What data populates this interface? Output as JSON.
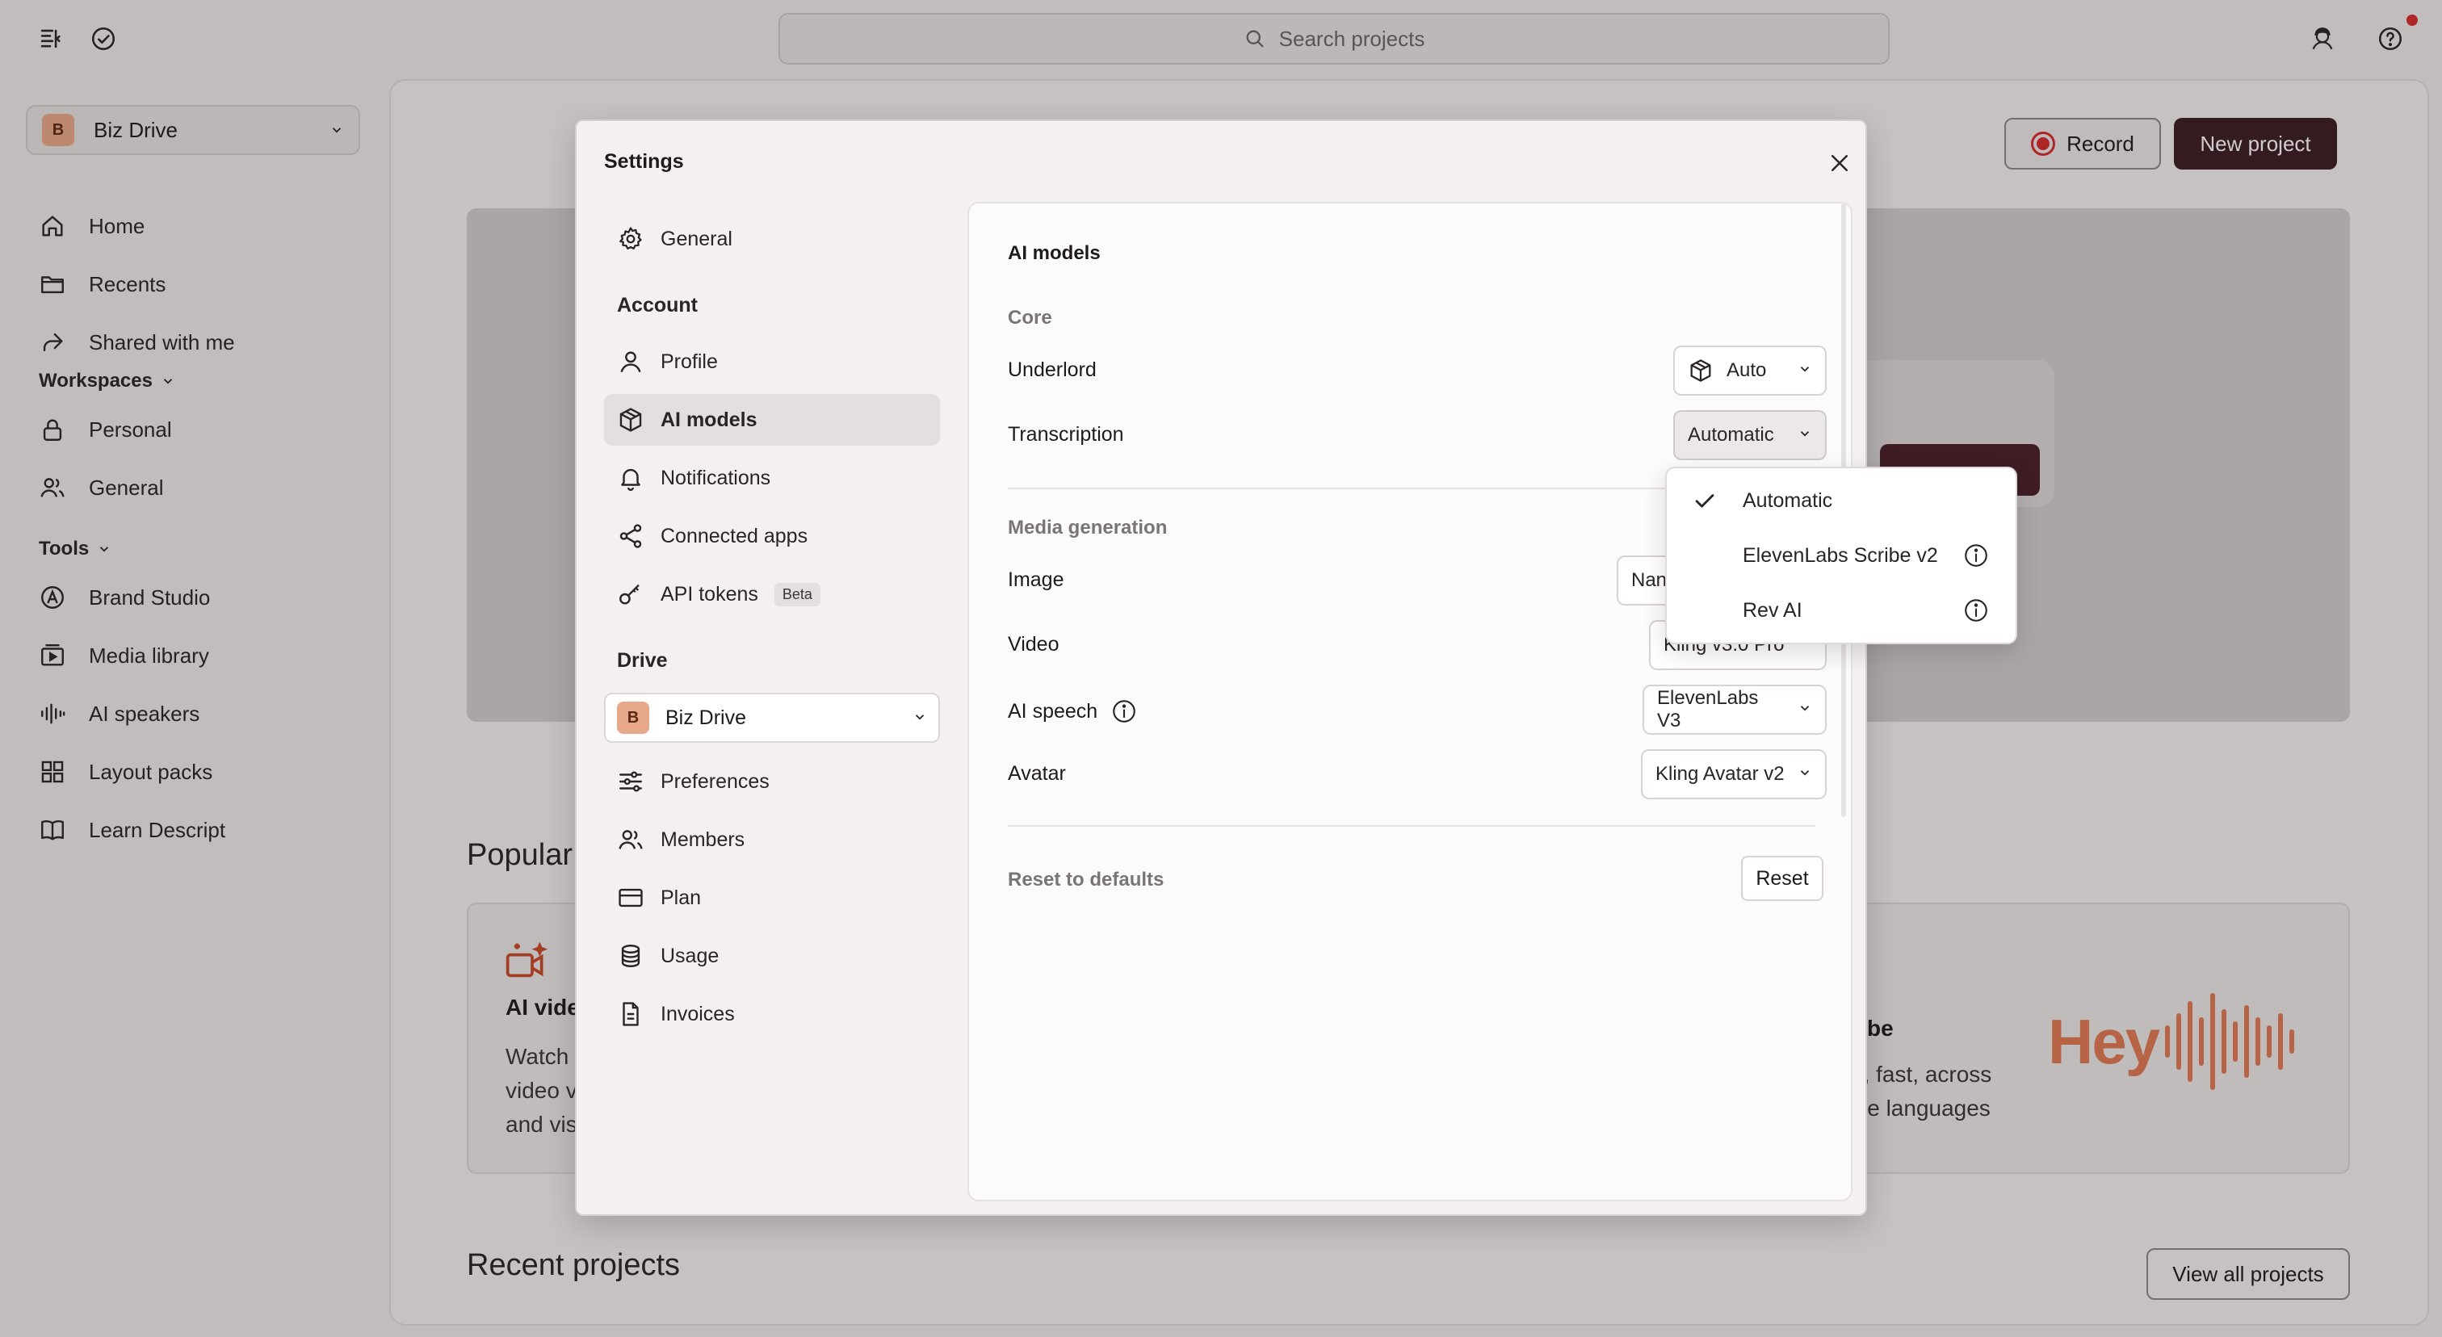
{
  "topbar": {
    "search_placeholder": "Search projects"
  },
  "sidebar": {
    "drive": {
      "initial": "B",
      "name": "Biz Drive"
    },
    "items": [
      {
        "label": "Home",
        "icon": "home-icon"
      },
      {
        "label": "Recents",
        "icon": "folder-icon"
      },
      {
        "label": "Shared with me",
        "icon": "share-icon"
      }
    ],
    "workspaces_label": "Workspaces",
    "workspaces": [
      {
        "label": "Personal",
        "icon": "lock-icon"
      },
      {
        "label": "General",
        "icon": "users-icon"
      }
    ],
    "tools_label": "Tools",
    "tools": [
      {
        "label": "Brand Studio",
        "icon": "brand-icon"
      },
      {
        "label": "Media library",
        "icon": "media-icon"
      },
      {
        "label": "AI speakers",
        "icon": "waveform-icon"
      },
      {
        "label": "Layout packs",
        "icon": "grid-icon"
      },
      {
        "label": "Learn Descript",
        "icon": "book-icon"
      }
    ]
  },
  "main": {
    "record_label": "Record",
    "new_project_label": "New project",
    "popular_label": "Popular",
    "card_left": {
      "title": "AI vide",
      "desc_line1": "Watch",
      "desc_line2": "video v",
      "desc_line3": "and vis"
    },
    "card_right": {
      "title": "be",
      "desc_line1": "e, fast, across",
      "desc_line2": "ive languages",
      "hey": "Hey"
    },
    "recent_label": "Recent projects",
    "view_all_label": "View all projects"
  },
  "settings": {
    "title": "Settings",
    "general_label": "General",
    "account_label": "Account",
    "account_items": [
      {
        "label": "Profile"
      },
      {
        "label": "AI models"
      },
      {
        "label": "Notifications"
      },
      {
        "label": "Connected apps"
      },
      {
        "label": "API tokens",
        "badge": "Beta"
      }
    ],
    "drive_label": "Drive",
    "drive": {
      "initial": "B",
      "name": "Biz Drive"
    },
    "drive_items": [
      {
        "label": "Preferences"
      },
      {
        "label": "Members"
      },
      {
        "label": "Plan"
      },
      {
        "label": "Usage"
      },
      {
        "label": "Invoices"
      }
    ],
    "panel": {
      "title": "AI models",
      "core_label": "Core",
      "underlord_label": "Underlord",
      "underlord_value": "Auto",
      "transcription_label": "Transcription",
      "transcription_value": "Automatic",
      "media_label": "Media generation",
      "image_label": "Image",
      "image_value": "Nanc",
      "video_label": "Video",
      "video_value": "Kling v3.0 Pro",
      "speech_label": "AI speech",
      "speech_value": "ElevenLabs V3",
      "avatar_label": "Avatar",
      "avatar_value": "Kling Avatar v2",
      "reset_label": "Reset to defaults",
      "reset_button": "Reset"
    },
    "dropdown": [
      {
        "label": "Automatic",
        "selected": true
      },
      {
        "label": "ElevenLabs Scribe v2",
        "info": true
      },
      {
        "label": "Rev AI",
        "info": true
      }
    ]
  }
}
